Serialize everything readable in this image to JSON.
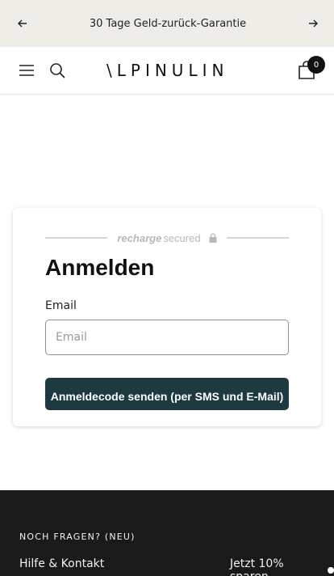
{
  "announcement": {
    "text": "30 Tage Geld-zurück-Garantie",
    "prev_icon": "arrow-left-icon",
    "next_icon": "arrow-right-icon"
  },
  "header": {
    "logo_text": "\\LPINULIN",
    "menu_icon": "hamburger-icon",
    "search_icon": "search-icon",
    "cart_icon": "shopping-bag-icon",
    "cart_count": "0"
  },
  "login_card": {
    "secured": {
      "brand": "recharge",
      "text": "secured",
      "icon": "lock-icon"
    },
    "title": "Anmelden",
    "email_label": "Email",
    "email_placeholder": "Email",
    "email_value": "",
    "submit_label": "Anmeldecode senden (per SMS und E-Mail)"
  },
  "footer": {
    "heading": "NOCH FRAGEN? (NEU)",
    "link": "Hilfe & Kontakt",
    "promo": "Jetzt 10% sparen"
  },
  "colors": {
    "announcement_bg": "#efede8",
    "button_bg": "#1d3a40",
    "footer_bg": "#1a1a1a"
  }
}
